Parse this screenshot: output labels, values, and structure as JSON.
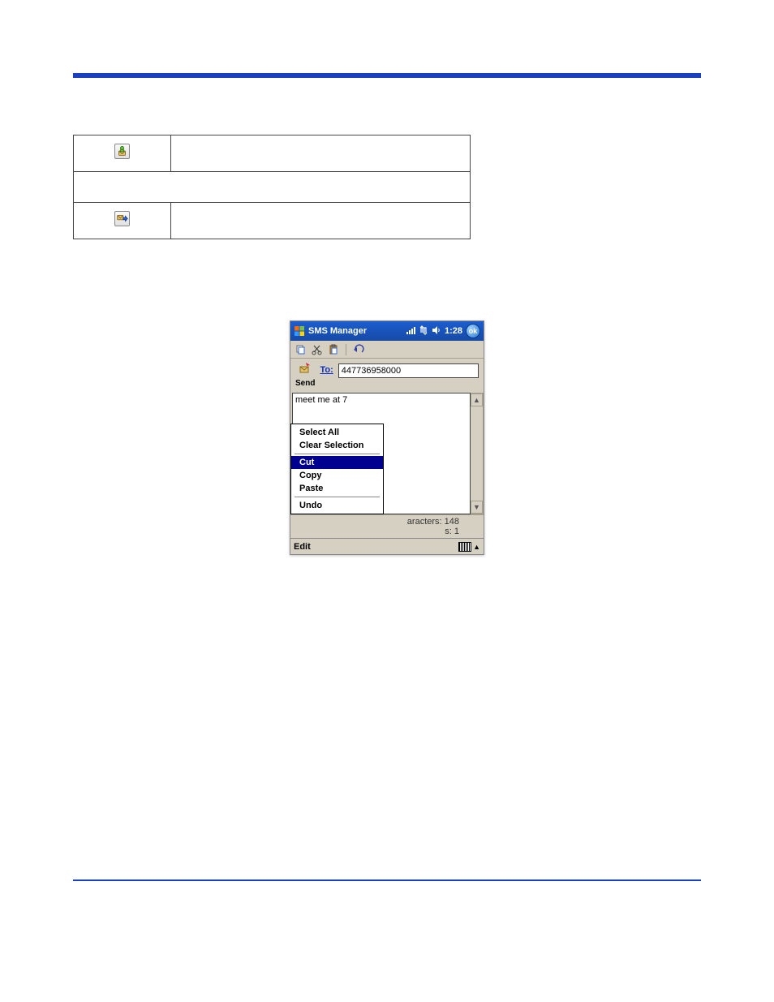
{
  "table": {
    "row1_desc": "",
    "row2_full": "",
    "row3_desc": ""
  },
  "device": {
    "title": "SMS Manager",
    "time": "1:28",
    "ok": "ok",
    "send_label": "Send",
    "to_label": "To:",
    "to_value": "447736958000",
    "message": "meet me at 7",
    "status_char_label": "aracters: 148",
    "status_msgs_label": "s: 1",
    "taskbar_edit": "Edit",
    "menu": {
      "select_all": "Select All",
      "clear_selection": "Clear Selection",
      "cut": "Cut",
      "copy": "Copy",
      "paste": "Paste",
      "undo": "Undo"
    }
  }
}
